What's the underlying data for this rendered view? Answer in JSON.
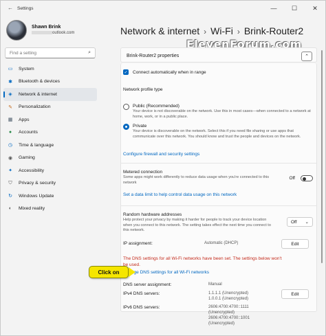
{
  "window": {
    "title": "Settings",
    "minimize": "—",
    "maximize": "☐",
    "close": "✕"
  },
  "profile": {
    "name": "Shawn Brink",
    "email": "outlook.com"
  },
  "search": {
    "placeholder": "Find a setting"
  },
  "nav": [
    {
      "label": "System",
      "icon": "system-icon"
    },
    {
      "label": "Bluetooth & devices",
      "icon": "bluetooth-icon"
    },
    {
      "label": "Network & internet",
      "icon": "network-icon",
      "active": true
    },
    {
      "label": "Personalization",
      "icon": "brush-icon"
    },
    {
      "label": "Apps",
      "icon": "apps-icon"
    },
    {
      "label": "Accounts",
      "icon": "accounts-icon"
    },
    {
      "label": "Time & language",
      "icon": "clock-icon"
    },
    {
      "label": "Gaming",
      "icon": "gaming-icon"
    },
    {
      "label": "Accessibility",
      "icon": "accessibility-icon"
    },
    {
      "label": "Privacy & security",
      "icon": "shield-icon"
    },
    {
      "label": "Windows Update",
      "icon": "update-icon"
    },
    {
      "label": "Mixed reality",
      "icon": "mixed-reality-icon"
    }
  ],
  "breadcrumb": {
    "part1": "Network & internet",
    "part2": "Wi-Fi",
    "part3": "Brink-Router2",
    "sep": "›"
  },
  "watermark": "ElevenForum.com",
  "properties": {
    "header": "Brink-Router2 properties",
    "auto_connect": "Connect automatically when in range",
    "profile_type_label": "Network profile type",
    "public_title": "Public (Recommended)",
    "public_desc": "Your device is not discoverable on the network. Use this in most cases—when connected to a network at home, work, or in a public place.",
    "private_title": "Private",
    "private_desc": "Your device is discoverable on the network. Select this if you need file sharing or use apps that communicate over this network. You should know and trust the people and devices on the network.",
    "firewall_link": "Configure firewall and security settings",
    "metered_title": "Metered connection",
    "metered_desc": "Some apps might work differently to reduce data usage when you're connected to this network",
    "metered_state": "Off",
    "data_limit_link": "Set a data limit to help control data usage on this network",
    "random_hw_title": "Random hardware addresses",
    "random_hw_desc": "Help protect your privacy by making it harder for people to track your device location when you connect to this network. The setting takes effect the next time you connect to this network.",
    "random_hw_value": "Off",
    "ip_assignment_label": "IP assignment:",
    "ip_assignment_value": "Automatic (DHCP)",
    "edit_label": "Edit",
    "dns_warning": "The DNS settings for all Wi-Fi networks have been set. The settings below won't be used.",
    "change_dns_link": "Change DNS settings for all Wi-Fi networks",
    "dns_assignment_label": "DNS server assignment:",
    "dns_assignment_value": "Manual",
    "ipv4_label": "IPv4 DNS servers:",
    "ipv4_value_1": "1.1.1.1 (Unencrypted)",
    "ipv4_value_2": "1.0.0.1 (Unencrypted)",
    "ipv6_label": "IPv6 DNS servers:",
    "ipv6_value_1": "2606:4700:4700::1111",
    "ipv6_value_2": "(Unencrypted)",
    "ipv6_value_3": "2606:4700:4700::1001",
    "ipv6_value_4": "(Unencrypted)"
  },
  "callout": "Click on",
  "colors": {
    "accent": "#0067c0",
    "warning": "#c42b1c",
    "callout": "#f5e600"
  }
}
